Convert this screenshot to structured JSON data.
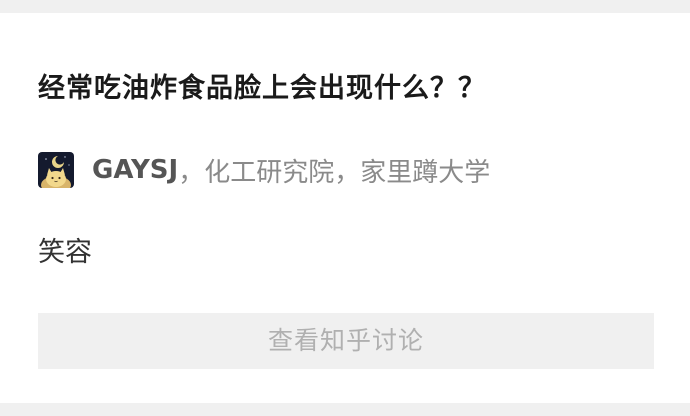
{
  "card": {
    "title": "经常吃油炸食品脸上会出现什么？？",
    "author": {
      "name": "GAYSJ",
      "bio": "，化工研究院，家里蹲大学",
      "avatar_icon": "cat-avatar-icon"
    },
    "answer": "笑容",
    "button_label": "查看知乎讨论"
  },
  "colors": {
    "background": "#f0f0f0",
    "card": "#ffffff",
    "title": "#1a1a1a",
    "author_name": "#555555",
    "bio": "#8a8a8a",
    "button_bg": "#f0f0f0",
    "button_text": "#b0b0b0"
  }
}
